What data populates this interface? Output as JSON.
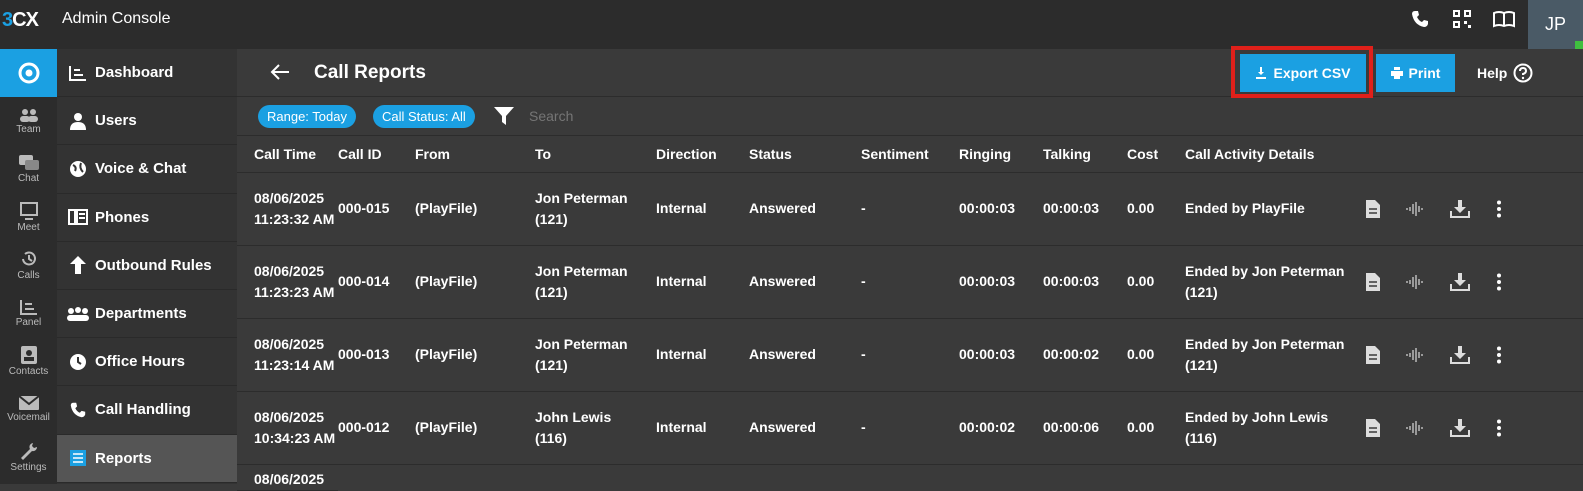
{
  "app": {
    "logo_three": "3",
    "logo_cx": "CX",
    "title": "Admin Console",
    "user_initials": "JP"
  },
  "rail": [
    {
      "label": "",
      "icon": "chrome-icon"
    },
    {
      "label": "Team",
      "icon": "team-icon"
    },
    {
      "label": "Chat",
      "icon": "chat-icon"
    },
    {
      "label": "Meet",
      "icon": "meet-icon"
    },
    {
      "label": "Calls",
      "icon": "calls-icon"
    },
    {
      "label": "Panel",
      "icon": "panel-icon"
    },
    {
      "label": "Contacts",
      "icon": "contacts-icon"
    },
    {
      "label": "Voicemail",
      "icon": "voicemail-icon"
    },
    {
      "label": "Settings",
      "icon": "settings-icon"
    }
  ],
  "nav": [
    {
      "label": "Dashboard",
      "icon": "dashboard-icon"
    },
    {
      "label": "Users",
      "icon": "user-icon"
    },
    {
      "label": "Voice & Chat",
      "icon": "globe-icon"
    },
    {
      "label": "Phones",
      "icon": "phones-icon"
    },
    {
      "label": "Outbound Rules",
      "icon": "arrow-up-icon"
    },
    {
      "label": "Departments",
      "icon": "departments-icon"
    },
    {
      "label": "Office Hours",
      "icon": "clock-icon"
    },
    {
      "label": "Call Handling",
      "icon": "phone-icon"
    },
    {
      "label": "Reports",
      "icon": "reports-icon"
    }
  ],
  "header": {
    "title": "Call Reports",
    "export_label": "Export CSV",
    "print_label": "Print",
    "help_label": "Help"
  },
  "filters": {
    "range": "Range: Today",
    "status": "Call Status: All",
    "search_placeholder": "Search"
  },
  "table": {
    "columns": [
      "Call Time",
      "Call ID",
      "From",
      "To",
      "Direction",
      "Status",
      "Sentiment",
      "Ringing",
      "Talking",
      "Cost",
      "Call Activity Details"
    ],
    "rows": [
      [
        "08/06/2025 11:23:32 AM",
        "000-015",
        "(PlayFile)",
        "Jon Peterman (121)",
        "Internal",
        "Answered",
        "-",
        "00:00:03",
        "00:00:03",
        "0.00",
        "Ended by PlayFile"
      ],
      [
        "08/06/2025 11:23:23 AM",
        "000-014",
        "(PlayFile)",
        "Jon Peterman (121)",
        "Internal",
        "Answered",
        "-",
        "00:00:03",
        "00:00:03",
        "0.00",
        "Ended by Jon Peterman (121)"
      ],
      [
        "08/06/2025 11:23:14 AM",
        "000-013",
        "(PlayFile)",
        "Jon Peterman (121)",
        "Internal",
        "Answered",
        "-",
        "00:00:03",
        "00:00:02",
        "0.00",
        "Ended by Jon Peterman (121)"
      ],
      [
        "08/06/2025 10:34:23 AM",
        "000-012",
        "(PlayFile)",
        "John Lewis (116)",
        "Internal",
        "Answered",
        "-",
        "00:00:02",
        "00:00:06",
        "0.00",
        "Ended by John Lewis (116)"
      ]
    ],
    "partial_row_time": "08/06/2025"
  }
}
